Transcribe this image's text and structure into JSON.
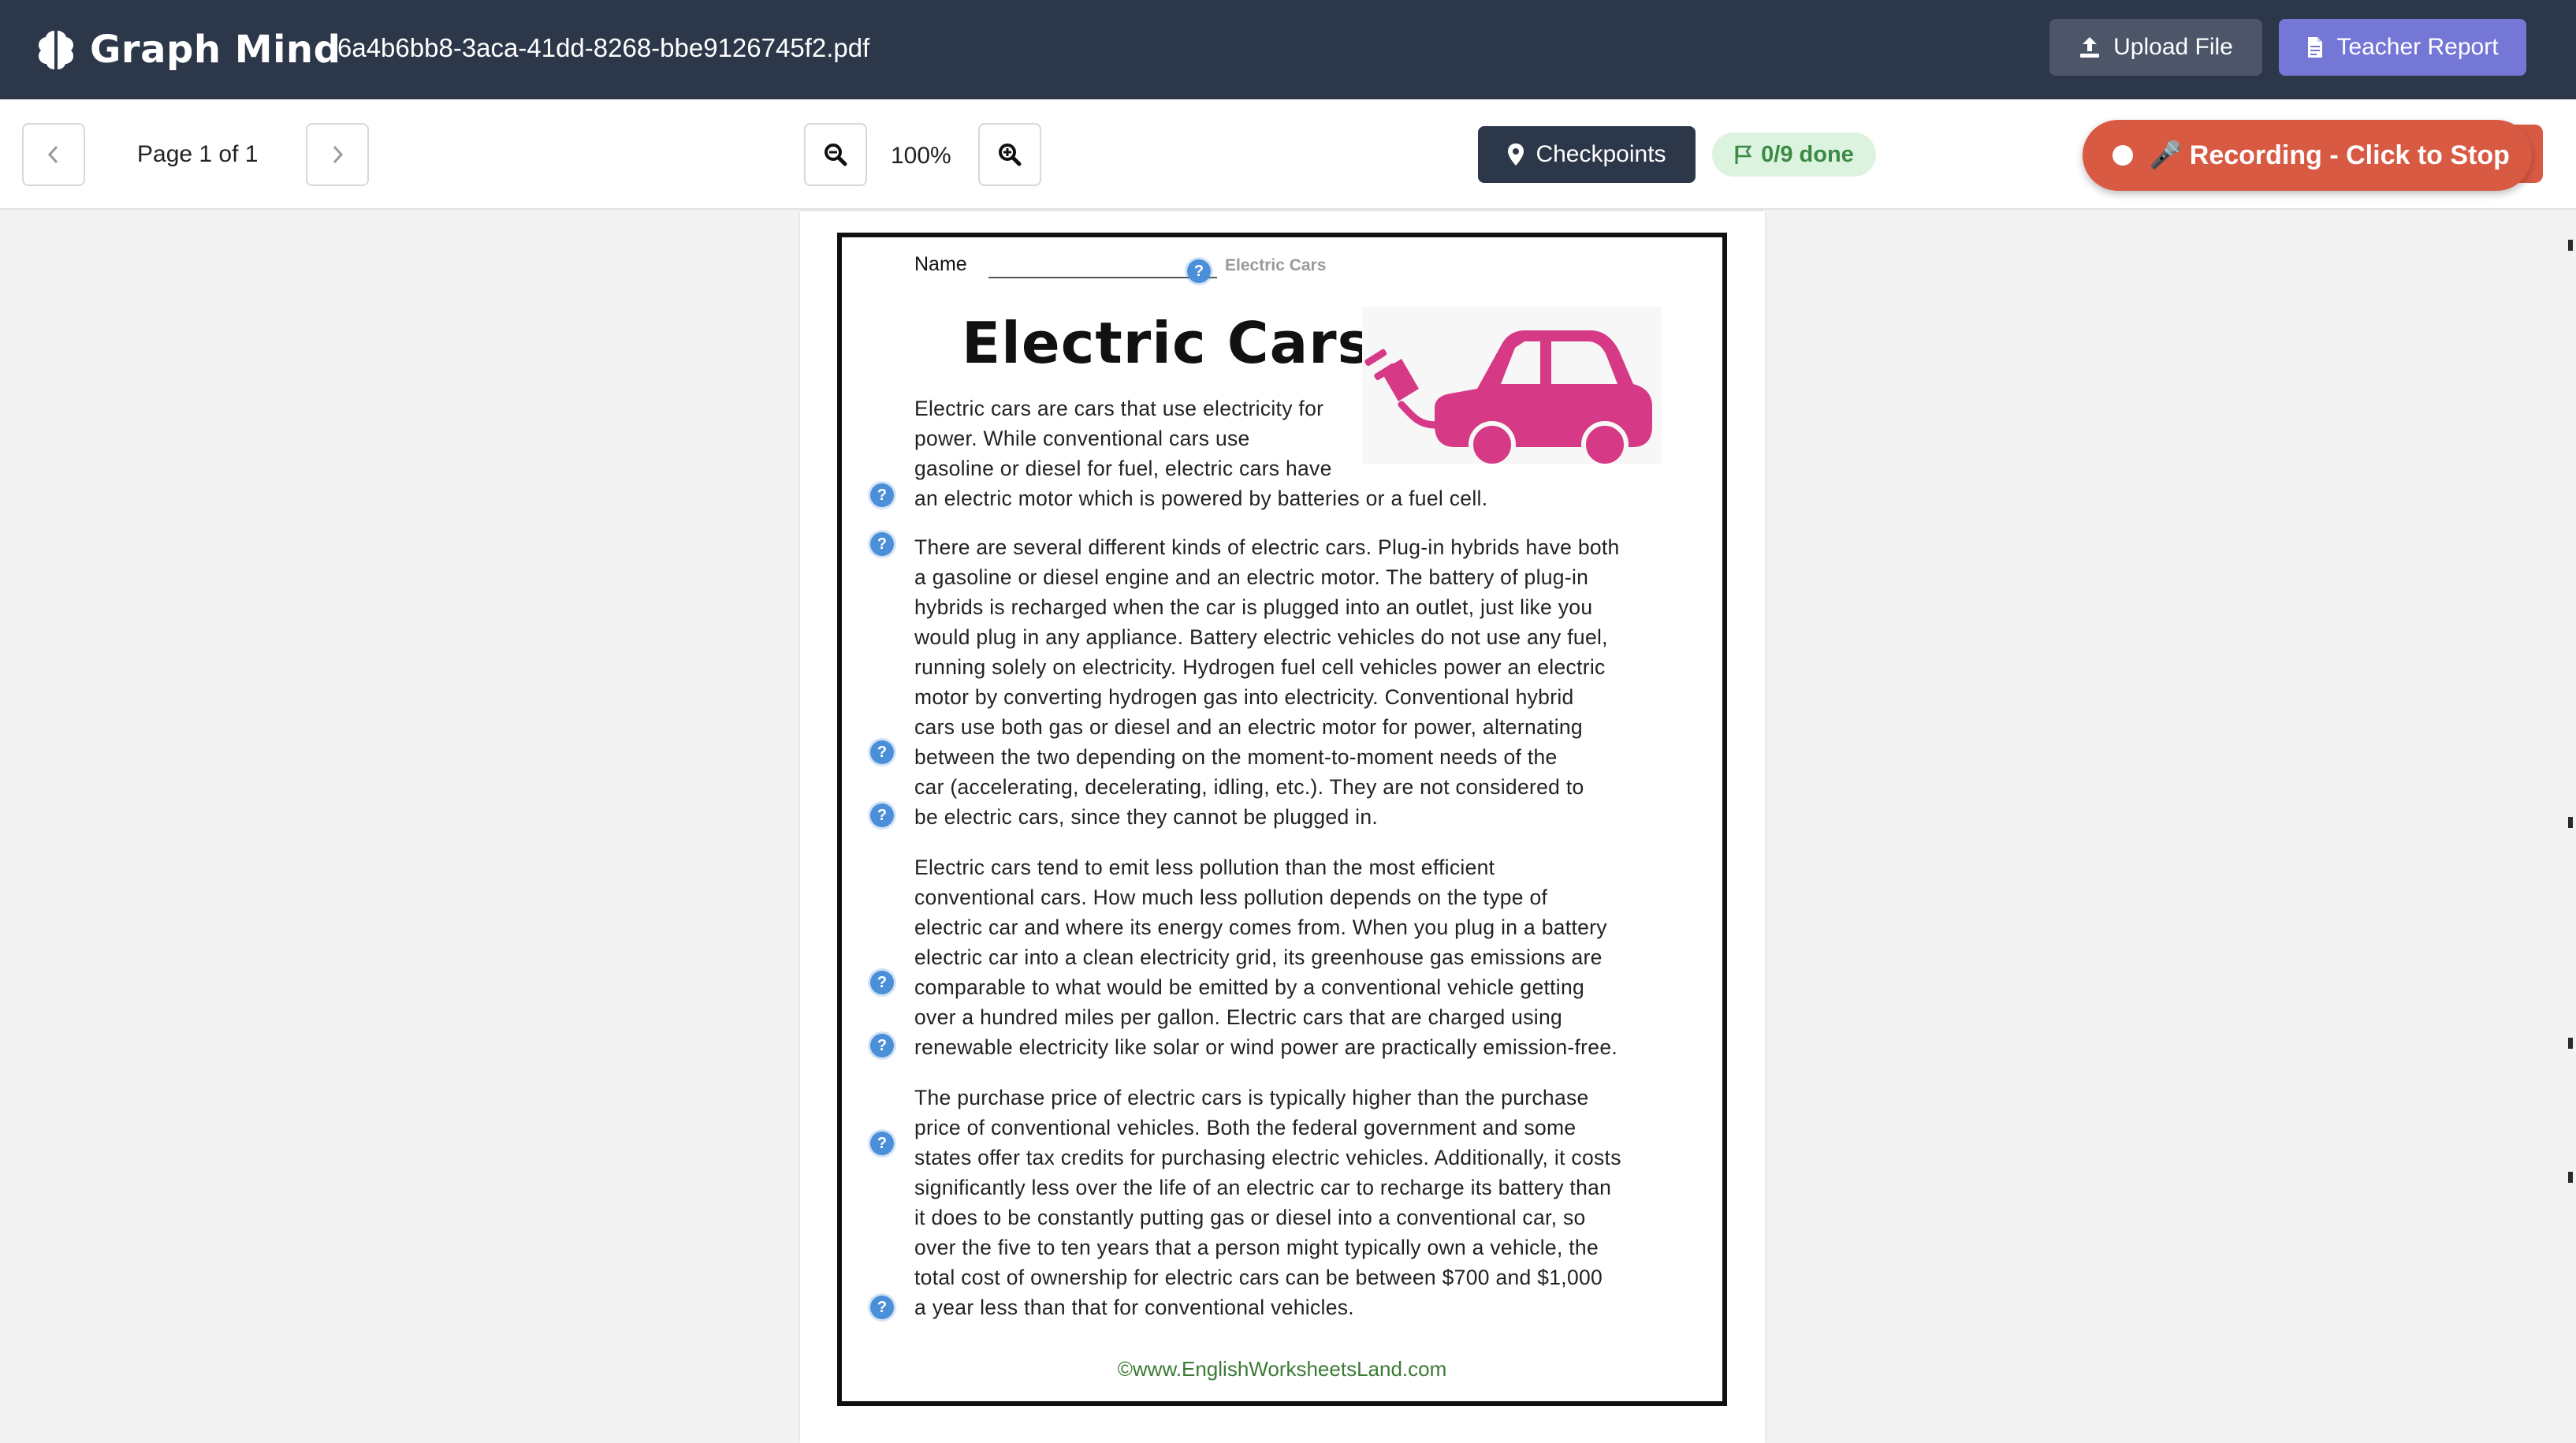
{
  "app": {
    "name": "Graph Mind",
    "filename": "6a4b6bb8-3aca-41dd-8268-bbe9126745f2.pdf",
    "upload_label": "Upload File",
    "report_label": "Teacher Report"
  },
  "toolbar": {
    "page_label": "Page 1 of 1",
    "zoom_label": "100%",
    "checkpoints_label": "Checkpoints",
    "progress_label": "0/9 done",
    "recording_label": "🎤 Recording - Click to Stop"
  },
  "worksheet": {
    "name_label": "Name",
    "header_title": "Electric Cars",
    "title": "Electric Cars",
    "paragraphs": [
      [
        "Electric cars are cars that use electricity for",
        "power. While conventional cars use",
        "gasoline or diesel for fuel, electric cars have",
        "an electric motor which is powered by batteries or a fuel cell."
      ],
      [
        "There are several different kinds of electric cars. Plug-in hybrids have both",
        "a gasoline or diesel engine and an electric motor. The battery of plug-in",
        "hybrids is recharged when the car is plugged into an outlet, just like you",
        "would plug in any appliance. Battery electric vehicles do not use any fuel,",
        "running solely on electricity. Hydrogen fuel cell vehicles power an electric",
        "motor by converting hydrogen gas into electricity. Conventional hybrid",
        "cars use both gas or diesel and an electric motor for power, alternating",
        "between the two depending on the moment-to-moment needs of the",
        "car (accelerating, decelerating, idling, etc.). They are not considered to",
        "be electric cars, since they cannot be plugged in."
      ],
      [
        "Electric cars tend to emit less pollution than the most efficient",
        "conventional cars. How much less pollution depends on the type of",
        "electric car and where its energy comes from. When you plug in a battery",
        "electric car into a clean electricity grid, its greenhouse gas emissions are",
        "comparable to what would be emitted by a conventional vehicle getting",
        "over a hundred miles per gallon. Electric cars that are charged using",
        "renewable electricity like solar or wind power are practically emission-free."
      ],
      [
        "The purchase price of electric cars is typically higher than the purchase",
        "price of conventional vehicles. Both the federal government and some",
        "states offer tax credits for purchasing electric vehicles. Additionally, it costs",
        "significantly less over the life of an electric car to recharge its battery than",
        "it does to be constantly putting gas or diesel into a conventional car, so",
        "over the five to ten years that a person might typically own a vehicle, the",
        "total cost of ownership for electric cars can be between $700 and $1,000",
        "a year less than that for conventional vehicles."
      ]
    ],
    "footer": "©www.EnglishWorksheetsLand.com"
  },
  "checkpoint_marker_label": "?",
  "colors": {
    "appbar": "#2c3749",
    "report_button": "#7477d6",
    "recording": "#d95a43",
    "progress_badge_bg": "#dcf3df",
    "progress_badge_text": "#3a8a44",
    "checkpoint_marker": "#4a8fd8",
    "car": "#d63a86",
    "footer_link": "#3b7a35"
  },
  "icons": {
    "brand": "brain-icon",
    "upload": "upload-icon",
    "report": "document-icon",
    "prev": "chevron-left-icon",
    "next": "chevron-right-icon",
    "zoom_out": "zoom-out-icon",
    "zoom_in": "zoom-in-icon",
    "checkpoints": "map-pin-icon",
    "progress": "flag-icon"
  }
}
